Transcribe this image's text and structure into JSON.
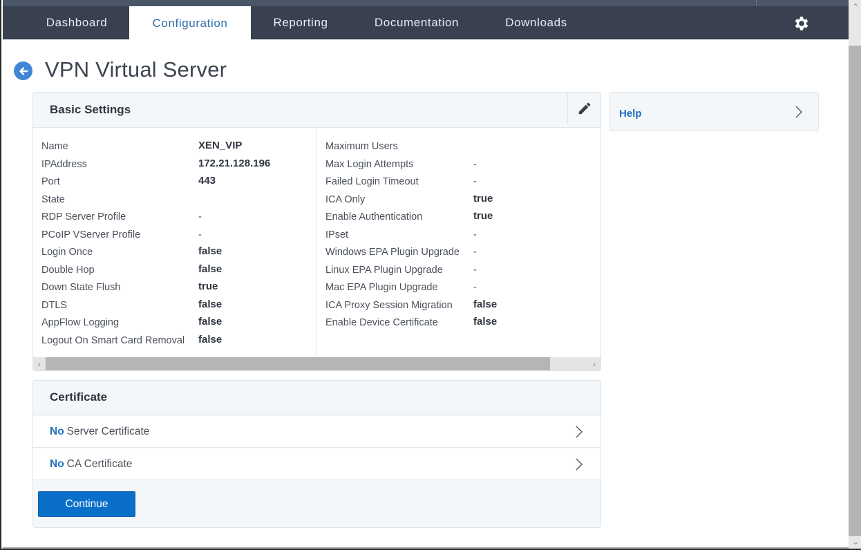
{
  "nav": {
    "tabs": [
      {
        "label": "Dashboard",
        "active": false
      },
      {
        "label": "Configuration",
        "active": true
      },
      {
        "label": "Reporting",
        "active": false
      },
      {
        "label": "Documentation",
        "active": false
      },
      {
        "label": "Downloads",
        "active": false
      }
    ],
    "settings_icon": "gear-icon"
  },
  "page": {
    "title": "VPN Virtual Server",
    "back_icon": "arrow-left-circle-icon"
  },
  "basic_settings": {
    "title": "Basic Settings",
    "edit_icon": "pencil-icon",
    "left": [
      {
        "label": "Name",
        "value": "XEN_VIP"
      },
      {
        "label": "IPAddress",
        "value": "172.21.128.196"
      },
      {
        "label": "Port",
        "value": "443"
      },
      {
        "label": "State",
        "value": ""
      },
      {
        "label": "RDP Server Profile",
        "value": "-"
      },
      {
        "label": "PCoIP VServer Profile",
        "value": "-"
      },
      {
        "label": "Login Once",
        "value": "false"
      },
      {
        "label": "Double Hop",
        "value": "false"
      },
      {
        "label": "Down State Flush",
        "value": "true"
      },
      {
        "label": "DTLS",
        "value": "false"
      },
      {
        "label": "AppFlow Logging",
        "value": "false"
      },
      {
        "label": "Logout On Smart Card Removal",
        "value": "false"
      }
    ],
    "right": [
      {
        "label": "Maximum Users",
        "value": ""
      },
      {
        "label": "Max Login Attempts",
        "value": "-"
      },
      {
        "label": "Failed Login Timeout",
        "value": "-"
      },
      {
        "label": "ICA Only",
        "value": "true"
      },
      {
        "label": "Enable Authentication",
        "value": "true"
      },
      {
        "label": "IPset",
        "value": "-"
      },
      {
        "label": "Windows EPA Plugin Upgrade",
        "value": "-"
      },
      {
        "label": "Linux EPA Plugin Upgrade",
        "value": "-"
      },
      {
        "label": "Mac EPA Plugin Upgrade",
        "value": "-"
      },
      {
        "label": "ICA Proxy Session Migration",
        "value": "false"
      },
      {
        "label": "Enable Device Certificate",
        "value": "false"
      }
    ]
  },
  "certificate": {
    "title": "Certificate",
    "rows": [
      {
        "prefix": "No",
        "label": "Server Certificate"
      },
      {
        "prefix": "No",
        "label": "CA Certificate"
      }
    ],
    "continue_label": "Continue"
  },
  "help": {
    "label": "Help"
  },
  "colors": {
    "nav_bg": "#394150",
    "accent": "#0a6fc9",
    "link": "#1f6fbd",
    "panel_header_bg": "#f4f7fa"
  }
}
